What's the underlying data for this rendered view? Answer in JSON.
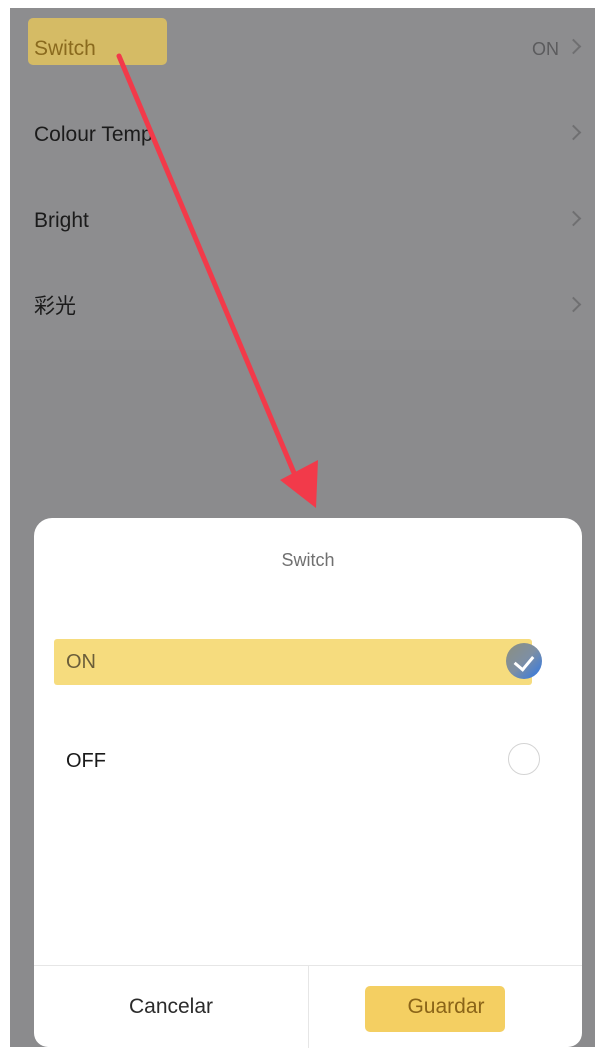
{
  "settings": {
    "rows": [
      {
        "label": "Switch",
        "value": "ON"
      },
      {
        "label": "Colour Temp"
      },
      {
        "label": "Bright"
      },
      {
        "label": "彩光"
      }
    ]
  },
  "dialog": {
    "title": "Switch",
    "options": [
      {
        "label": "ON",
        "selected": true
      },
      {
        "label": "OFF",
        "selected": false
      }
    ],
    "cancel_label": "Cancelar",
    "save_label": "Guardar"
  },
  "colors": {
    "highlight": "#f6dc7e",
    "annotation_arrow": "#f23a4a",
    "selected_radio": "#2d77e8"
  },
  "icons": [
    "chevron-right-icon",
    "checkmark-icon",
    "annotation-arrow-icon"
  ]
}
